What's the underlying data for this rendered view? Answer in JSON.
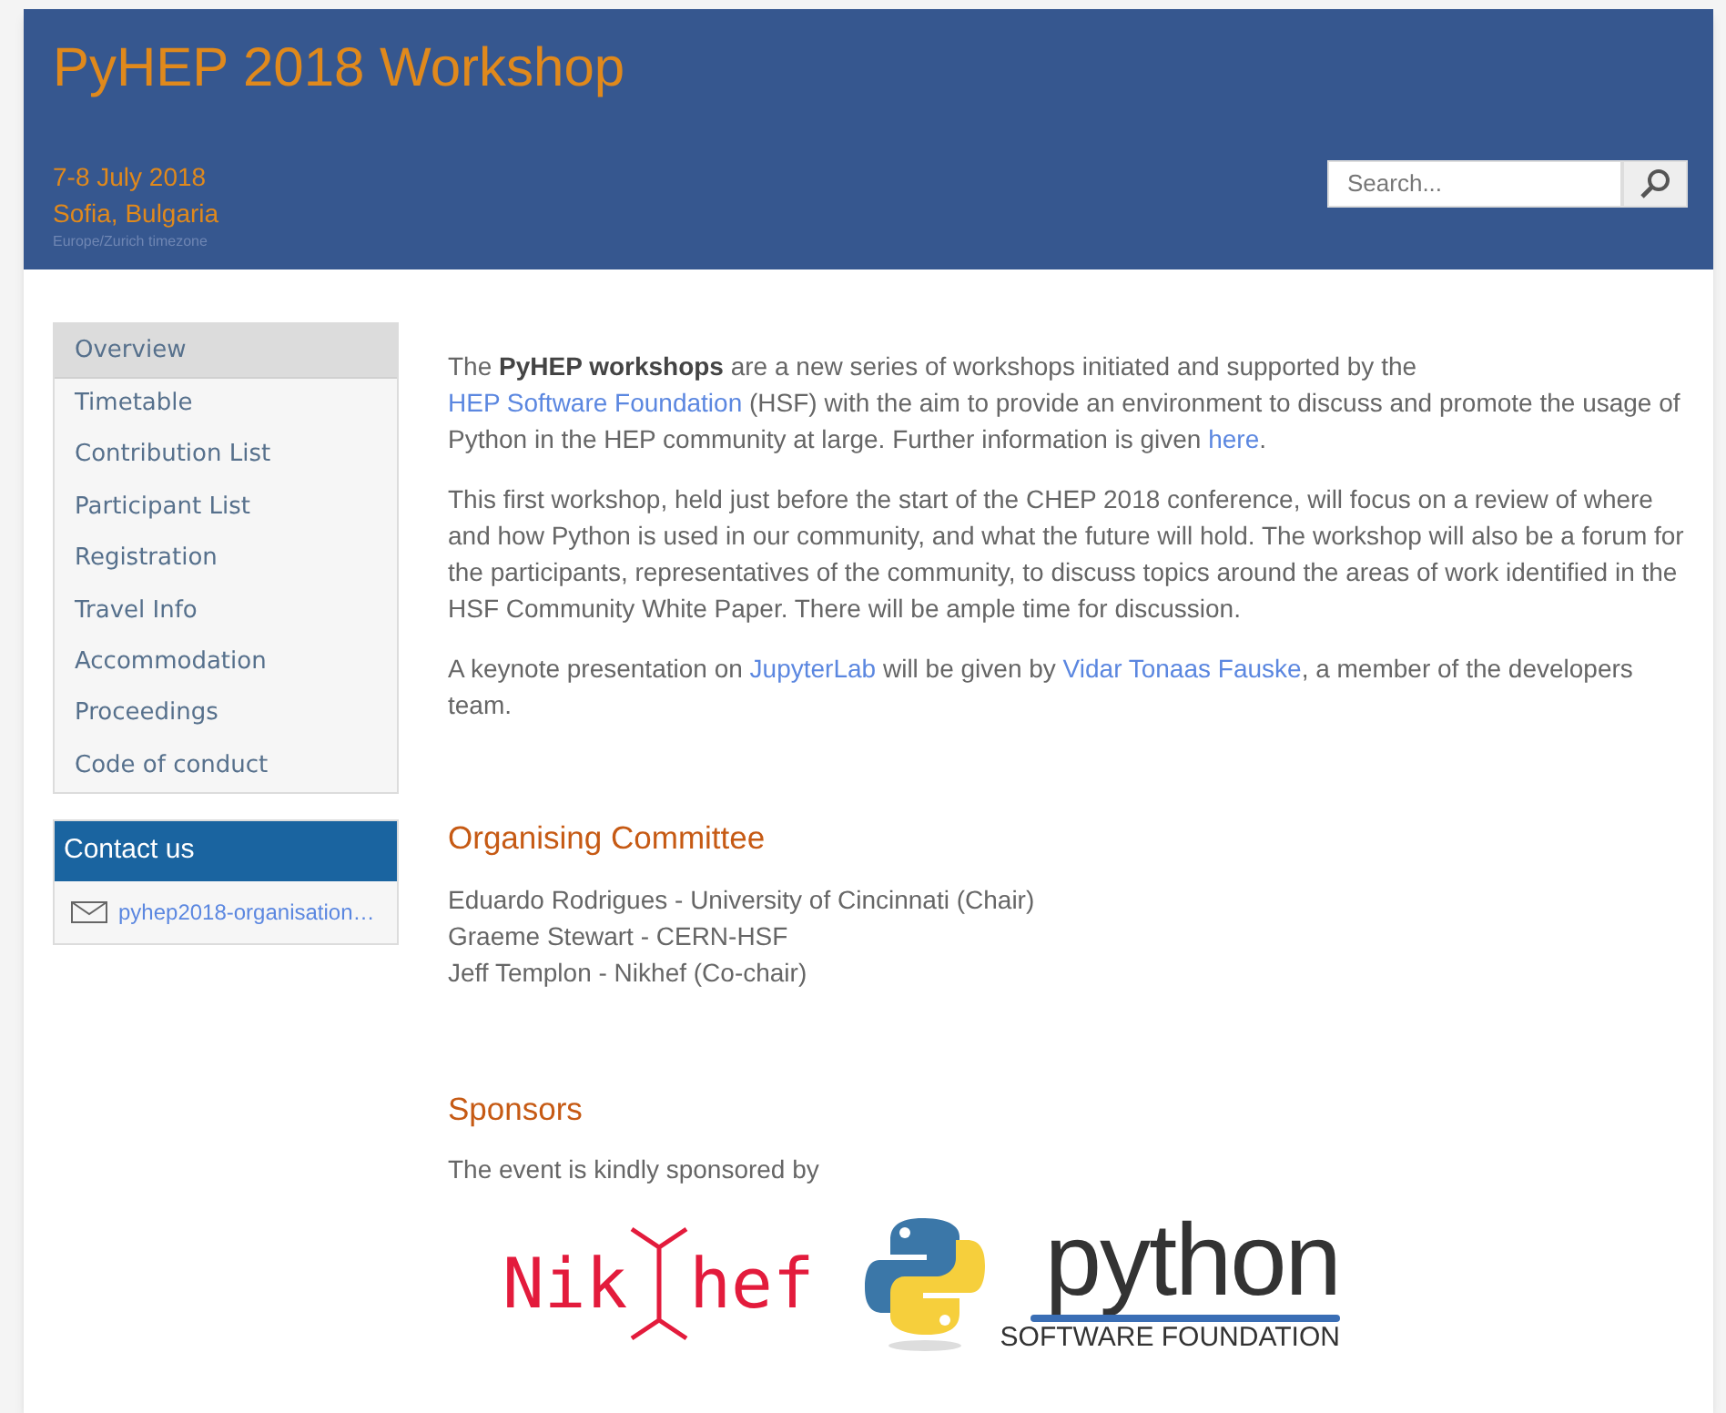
{
  "header": {
    "title": "PyHEP 2018 Workshop",
    "dates": "7-8 July 2018",
    "location": "Sofia, Bulgaria",
    "timezone": "Europe/Zurich timezone",
    "search": {
      "placeholder": "Search..."
    }
  },
  "menu": [
    {
      "label": "Overview",
      "selected": true
    },
    {
      "label": "Timetable",
      "selected": false
    },
    {
      "label": "Contribution List",
      "selected": false
    },
    {
      "label": "Participant List",
      "selected": false
    },
    {
      "label": "Registration",
      "selected": false
    },
    {
      "label": "Travel Info",
      "selected": false
    },
    {
      "label": "Accommodation",
      "selected": false
    },
    {
      "label": "Proceedings",
      "selected": false
    },
    {
      "label": "Code of conduct",
      "selected": false
    }
  ],
  "contact": {
    "title": "Contact us",
    "email": "pyhep2018-organisation…"
  },
  "intro": [
    [
      {
        "kind": "text",
        "text": "The "
      },
      {
        "kind": "bold",
        "text": "PyHEP workshops"
      },
      {
        "kind": "text",
        "text": " are a new series of workshops initiated and supported by the "
      },
      {
        "kind": "link",
        "text": "HEP Software Foundation"
      },
      {
        "kind": "text",
        "text": " (HSF) with the aim to provide an environment to discuss and promote the usage of Python in the HEP community at large. Further information is given "
      },
      {
        "kind": "link",
        "text": "here"
      },
      {
        "kind": "text",
        "text": "."
      }
    ],
    [
      {
        "kind": "text",
        "text": "This first workshop, held just before the start of the CHEP 2018 conference, will focus on a review of where and how Python is used in our community, and what the future will hold. The workshop will also be a forum for the participants, representatives of the community, to discuss topics around the areas of work identified in the HSF Community White Paper. There will be ample time for discussion."
      }
    ],
    [
      {
        "kind": "text",
        "text": "A keynote presentation on "
      },
      {
        "kind": "link",
        "text": "JupyterLab"
      },
      {
        "kind": "text",
        "text": " will be given by "
      },
      {
        "kind": "link",
        "text": "Vidar Tonaas Fauske"
      },
      {
        "kind": "text",
        "text": ", a member of the developers team."
      }
    ]
  ],
  "committee": {
    "heading": "Organising Committee",
    "members": [
      "Eduardo Rodrigues - University of Cincinnati (Chair)",
      "Graeme Stewart - CERN-HSF",
      "Jeff Templon - Nikhef (Co-chair)"
    ]
  },
  "sponsors": {
    "heading": "Sponsors",
    "text": "The event is kindly sponsored by",
    "logos": [
      {
        "kind": "nikhef",
        "parts": [
          "Nik",
          "hef"
        ]
      },
      {
        "kind": "python",
        "parts": [
          "python",
          "SOFTWARE FOUNDATION"
        ]
      }
    ]
  }
}
